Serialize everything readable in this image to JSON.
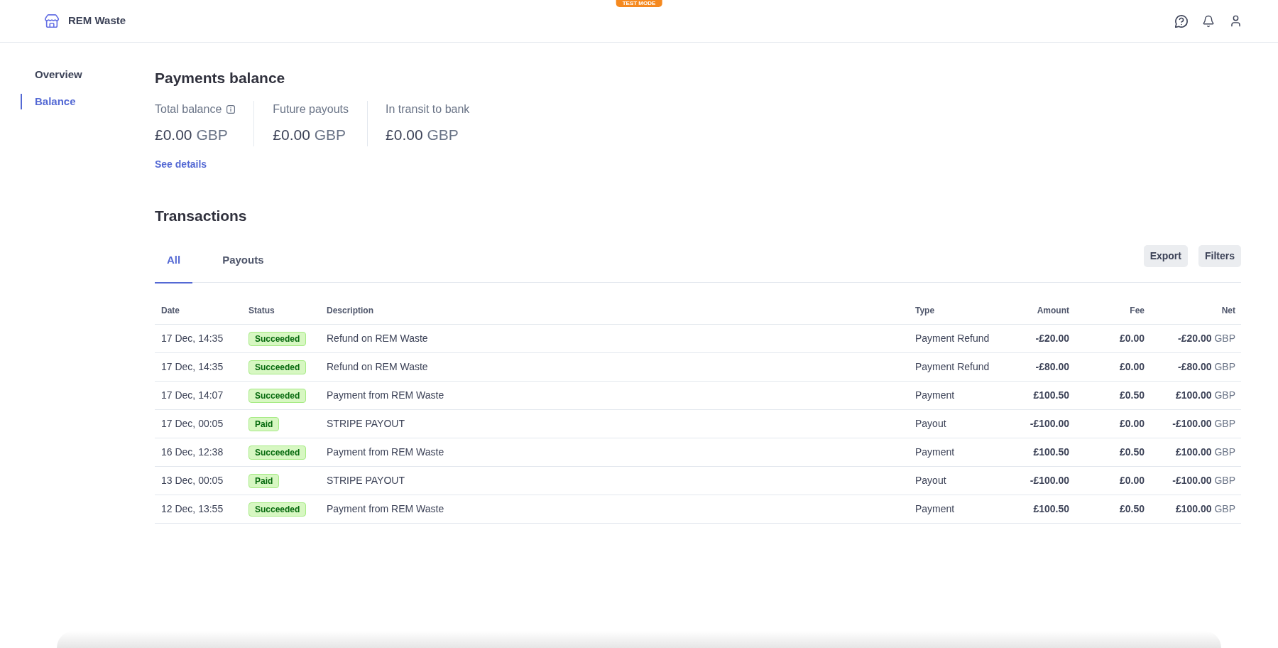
{
  "header": {
    "badge": "TEST MODE",
    "brand": "REM Waste"
  },
  "sidebar": {
    "items": [
      {
        "label": "Overview",
        "selected": false
      },
      {
        "label": "Balance",
        "selected": true
      }
    ]
  },
  "balance": {
    "title": "Payments balance",
    "cards": [
      {
        "label": "Total balance",
        "info_icon": true,
        "amount": "£0.00",
        "currency": "GBP"
      },
      {
        "label": "Future payouts",
        "info_icon": false,
        "amount": "£0.00",
        "currency": "GBP"
      },
      {
        "label": "In transit to bank",
        "info_icon": false,
        "amount": "£0.00",
        "currency": "GBP"
      }
    ],
    "link": "See details"
  },
  "transactions": {
    "title": "Transactions",
    "tabs": [
      {
        "label": "All",
        "selected": true
      },
      {
        "label": "Payouts",
        "selected": false
      }
    ],
    "buttons": [
      "Export",
      "Filters"
    ],
    "columns": [
      "Date",
      "Status",
      "Description",
      "Type",
      "Amount",
      "Fee",
      "Net"
    ],
    "rows": [
      {
        "date": "17 Dec, 14:35",
        "status": "Succeeded",
        "description": "Refund on REM Waste",
        "type": "Payment Refund",
        "amount": "-£20.00",
        "fee": "£0.00",
        "net": "-£20.00",
        "currency": "GBP"
      },
      {
        "date": "17 Dec, 14:35",
        "status": "Succeeded",
        "description": "Refund on REM Waste",
        "type": "Payment Refund",
        "amount": "-£80.00",
        "fee": "£0.00",
        "net": "-£80.00",
        "currency": "GBP"
      },
      {
        "date": "17 Dec, 14:07",
        "status": "Succeeded",
        "description": "Payment from REM Waste",
        "type": "Payment",
        "amount": "£100.50",
        "fee": "£0.50",
        "net": "£100.00",
        "currency": "GBP"
      },
      {
        "date": "17 Dec, 00:05",
        "status": "Paid",
        "description": "STRIPE PAYOUT",
        "type": "Payout",
        "amount": "-£100.00",
        "fee": "£0.00",
        "net": "-£100.00",
        "currency": "GBP"
      },
      {
        "date": "16 Dec, 12:38",
        "status": "Succeeded",
        "description": "Payment from REM Waste",
        "type": "Payment",
        "amount": "£100.50",
        "fee": "£0.50",
        "net": "£100.00",
        "currency": "GBP"
      },
      {
        "date": "13 Dec, 00:05",
        "status": "Paid",
        "description": "STRIPE PAYOUT",
        "type": "Payout",
        "amount": "-£100.00",
        "fee": "£0.00",
        "net": "-£100.00",
        "currency": "GBP"
      },
      {
        "date": "12 Dec, 13:55",
        "status": "Succeeded",
        "description": "Payment from REM Waste",
        "type": "Payment",
        "amount": "£100.50",
        "fee": "£0.50",
        "net": "£100.00",
        "currency": "GBP"
      }
    ]
  }
}
